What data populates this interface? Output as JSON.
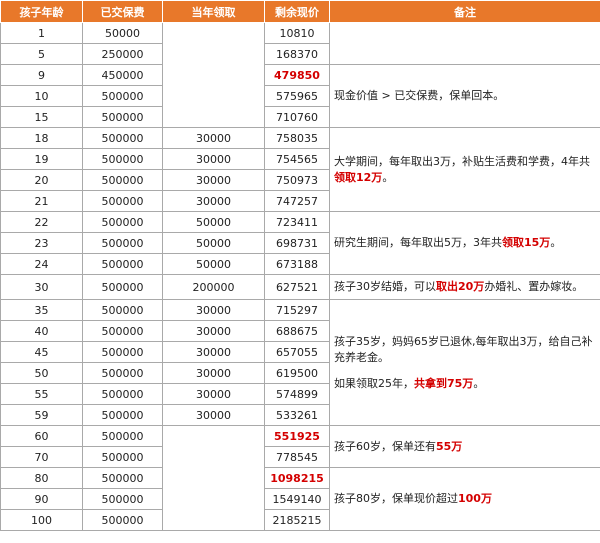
{
  "headers": [
    "孩子年龄",
    "已交保费",
    "当年领取",
    "剩余现价",
    "备注"
  ],
  "rows": [
    {
      "age": "1",
      "premium": "50000",
      "withdraw": "",
      "value": "10810"
    },
    {
      "age": "5",
      "premium": "250000",
      "withdraw": "",
      "value": "168370"
    },
    {
      "age": "9",
      "premium": "450000",
      "withdraw": "",
      "value": "479850"
    },
    {
      "age": "10",
      "premium": "500000",
      "withdraw": "",
      "value": "575965"
    },
    {
      "age": "15",
      "premium": "500000",
      "withdraw": "",
      "value": "710760"
    },
    {
      "age": "18",
      "premium": "500000",
      "withdraw": "30000",
      "value": "758035"
    },
    {
      "age": "19",
      "premium": "500000",
      "withdraw": "30000",
      "value": "754565"
    },
    {
      "age": "20",
      "premium": "500000",
      "withdraw": "30000",
      "value": "750973"
    },
    {
      "age": "21",
      "premium": "500000",
      "withdraw": "30000",
      "value": "747257"
    },
    {
      "age": "22",
      "premium": "500000",
      "withdraw": "50000",
      "value": "723411"
    },
    {
      "age": "23",
      "premium": "500000",
      "withdraw": "50000",
      "value": "698731"
    },
    {
      "age": "24",
      "premium": "500000",
      "withdraw": "50000",
      "value": "673188"
    },
    {
      "age": "30",
      "premium": "500000",
      "withdraw": "200000",
      "value": "627521"
    },
    {
      "age": "35",
      "premium": "500000",
      "withdraw": "30000",
      "value": "715297"
    },
    {
      "age": "40",
      "premium": "500000",
      "withdraw": "30000",
      "value": "688675"
    },
    {
      "age": "45",
      "premium": "500000",
      "withdraw": "30000",
      "value": "657055"
    },
    {
      "age": "50",
      "premium": "500000",
      "withdraw": "30000",
      "value": "619500"
    },
    {
      "age": "55",
      "premium": "500000",
      "withdraw": "30000",
      "value": "574899"
    },
    {
      "age": "59",
      "premium": "500000",
      "withdraw": "30000",
      "value": "533261"
    },
    {
      "age": "60",
      "premium": "500000",
      "withdraw": "",
      "value": "551925"
    },
    {
      "age": "70",
      "premium": "500000",
      "withdraw": "",
      "value": "778545"
    },
    {
      "age": "80",
      "premium": "500000",
      "withdraw": "",
      "value": "1098215"
    },
    {
      "age": "90",
      "premium": "500000",
      "withdraw": "",
      "value": "1549140"
    },
    {
      "age": "100",
      "premium": "500000",
      "withdraw": "",
      "value": "2185215"
    }
  ],
  "notes": {
    "n1": {
      "t1": "现金价值 > 已交保费，保单回本。"
    },
    "n2": {
      "t1": "大学期间，每年取出3万，补贴生活费和学费，4年共",
      "r1": "领取12万",
      "t2": "。"
    },
    "n3": {
      "t1": "研究生期间，每年取出5万，3年共",
      "r1": "领取15万",
      "t2": "。"
    },
    "n4": {
      "t1": "孩子30岁结婚，可以",
      "r1": "取出20万",
      "t2": "办婚礼、置办嫁妆。"
    },
    "n5": {
      "p1": "孩子35岁，妈妈65岁已退休,每年取出3万，给自己补充养老金。",
      "t1": "如果领取25年，",
      "r1": "共拿到75万",
      "t2": "。"
    },
    "n6": {
      "t1": "孩子60岁，保单还有",
      "r1": "55万"
    },
    "n7": {
      "t1": "孩子80岁，保单现价超过",
      "r1": "100万"
    }
  },
  "colors": {
    "header_bg": "#E8782A",
    "highlight": "#D40000"
  }
}
